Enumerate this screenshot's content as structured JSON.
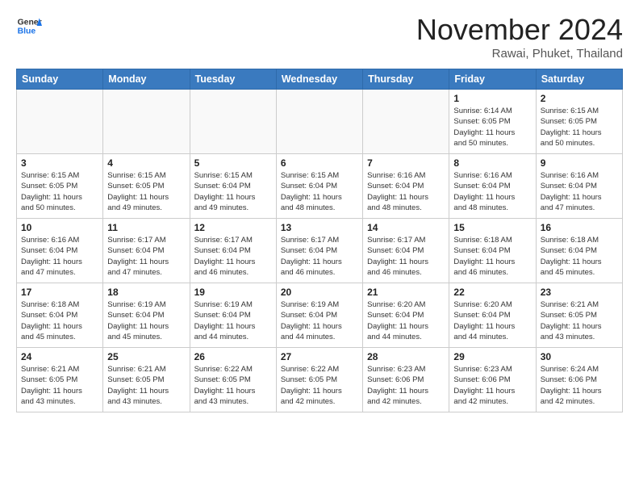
{
  "header": {
    "logo_general": "General",
    "logo_blue": "Blue",
    "month": "November 2024",
    "location": "Rawai, Phuket, Thailand"
  },
  "weekdays": [
    "Sunday",
    "Monday",
    "Tuesday",
    "Wednesday",
    "Thursday",
    "Friday",
    "Saturday"
  ],
  "weeks": [
    [
      {
        "day": "",
        "info": ""
      },
      {
        "day": "",
        "info": ""
      },
      {
        "day": "",
        "info": ""
      },
      {
        "day": "",
        "info": ""
      },
      {
        "day": "",
        "info": ""
      },
      {
        "day": "1",
        "info": "Sunrise: 6:14 AM\nSunset: 6:05 PM\nDaylight: 11 hours\nand 50 minutes."
      },
      {
        "day": "2",
        "info": "Sunrise: 6:15 AM\nSunset: 6:05 PM\nDaylight: 11 hours\nand 50 minutes."
      }
    ],
    [
      {
        "day": "3",
        "info": "Sunrise: 6:15 AM\nSunset: 6:05 PM\nDaylight: 11 hours\nand 50 minutes."
      },
      {
        "day": "4",
        "info": "Sunrise: 6:15 AM\nSunset: 6:05 PM\nDaylight: 11 hours\nand 49 minutes."
      },
      {
        "day": "5",
        "info": "Sunrise: 6:15 AM\nSunset: 6:04 PM\nDaylight: 11 hours\nand 49 minutes."
      },
      {
        "day": "6",
        "info": "Sunrise: 6:15 AM\nSunset: 6:04 PM\nDaylight: 11 hours\nand 48 minutes."
      },
      {
        "day": "7",
        "info": "Sunrise: 6:16 AM\nSunset: 6:04 PM\nDaylight: 11 hours\nand 48 minutes."
      },
      {
        "day": "8",
        "info": "Sunrise: 6:16 AM\nSunset: 6:04 PM\nDaylight: 11 hours\nand 48 minutes."
      },
      {
        "day": "9",
        "info": "Sunrise: 6:16 AM\nSunset: 6:04 PM\nDaylight: 11 hours\nand 47 minutes."
      }
    ],
    [
      {
        "day": "10",
        "info": "Sunrise: 6:16 AM\nSunset: 6:04 PM\nDaylight: 11 hours\nand 47 minutes."
      },
      {
        "day": "11",
        "info": "Sunrise: 6:17 AM\nSunset: 6:04 PM\nDaylight: 11 hours\nand 47 minutes."
      },
      {
        "day": "12",
        "info": "Sunrise: 6:17 AM\nSunset: 6:04 PM\nDaylight: 11 hours\nand 46 minutes."
      },
      {
        "day": "13",
        "info": "Sunrise: 6:17 AM\nSunset: 6:04 PM\nDaylight: 11 hours\nand 46 minutes."
      },
      {
        "day": "14",
        "info": "Sunrise: 6:17 AM\nSunset: 6:04 PM\nDaylight: 11 hours\nand 46 minutes."
      },
      {
        "day": "15",
        "info": "Sunrise: 6:18 AM\nSunset: 6:04 PM\nDaylight: 11 hours\nand 46 minutes."
      },
      {
        "day": "16",
        "info": "Sunrise: 6:18 AM\nSunset: 6:04 PM\nDaylight: 11 hours\nand 45 minutes."
      }
    ],
    [
      {
        "day": "17",
        "info": "Sunrise: 6:18 AM\nSunset: 6:04 PM\nDaylight: 11 hours\nand 45 minutes."
      },
      {
        "day": "18",
        "info": "Sunrise: 6:19 AM\nSunset: 6:04 PM\nDaylight: 11 hours\nand 45 minutes."
      },
      {
        "day": "19",
        "info": "Sunrise: 6:19 AM\nSunset: 6:04 PM\nDaylight: 11 hours\nand 44 minutes."
      },
      {
        "day": "20",
        "info": "Sunrise: 6:19 AM\nSunset: 6:04 PM\nDaylight: 11 hours\nand 44 minutes."
      },
      {
        "day": "21",
        "info": "Sunrise: 6:20 AM\nSunset: 6:04 PM\nDaylight: 11 hours\nand 44 minutes."
      },
      {
        "day": "22",
        "info": "Sunrise: 6:20 AM\nSunset: 6:04 PM\nDaylight: 11 hours\nand 44 minutes."
      },
      {
        "day": "23",
        "info": "Sunrise: 6:21 AM\nSunset: 6:05 PM\nDaylight: 11 hours\nand 43 minutes."
      }
    ],
    [
      {
        "day": "24",
        "info": "Sunrise: 6:21 AM\nSunset: 6:05 PM\nDaylight: 11 hours\nand 43 minutes."
      },
      {
        "day": "25",
        "info": "Sunrise: 6:21 AM\nSunset: 6:05 PM\nDaylight: 11 hours\nand 43 minutes."
      },
      {
        "day": "26",
        "info": "Sunrise: 6:22 AM\nSunset: 6:05 PM\nDaylight: 11 hours\nand 43 minutes."
      },
      {
        "day": "27",
        "info": "Sunrise: 6:22 AM\nSunset: 6:05 PM\nDaylight: 11 hours\nand 42 minutes."
      },
      {
        "day": "28",
        "info": "Sunrise: 6:23 AM\nSunset: 6:06 PM\nDaylight: 11 hours\nand 42 minutes."
      },
      {
        "day": "29",
        "info": "Sunrise: 6:23 AM\nSunset: 6:06 PM\nDaylight: 11 hours\nand 42 minutes."
      },
      {
        "day": "30",
        "info": "Sunrise: 6:24 AM\nSunset: 6:06 PM\nDaylight: 11 hours\nand 42 minutes."
      }
    ]
  ]
}
